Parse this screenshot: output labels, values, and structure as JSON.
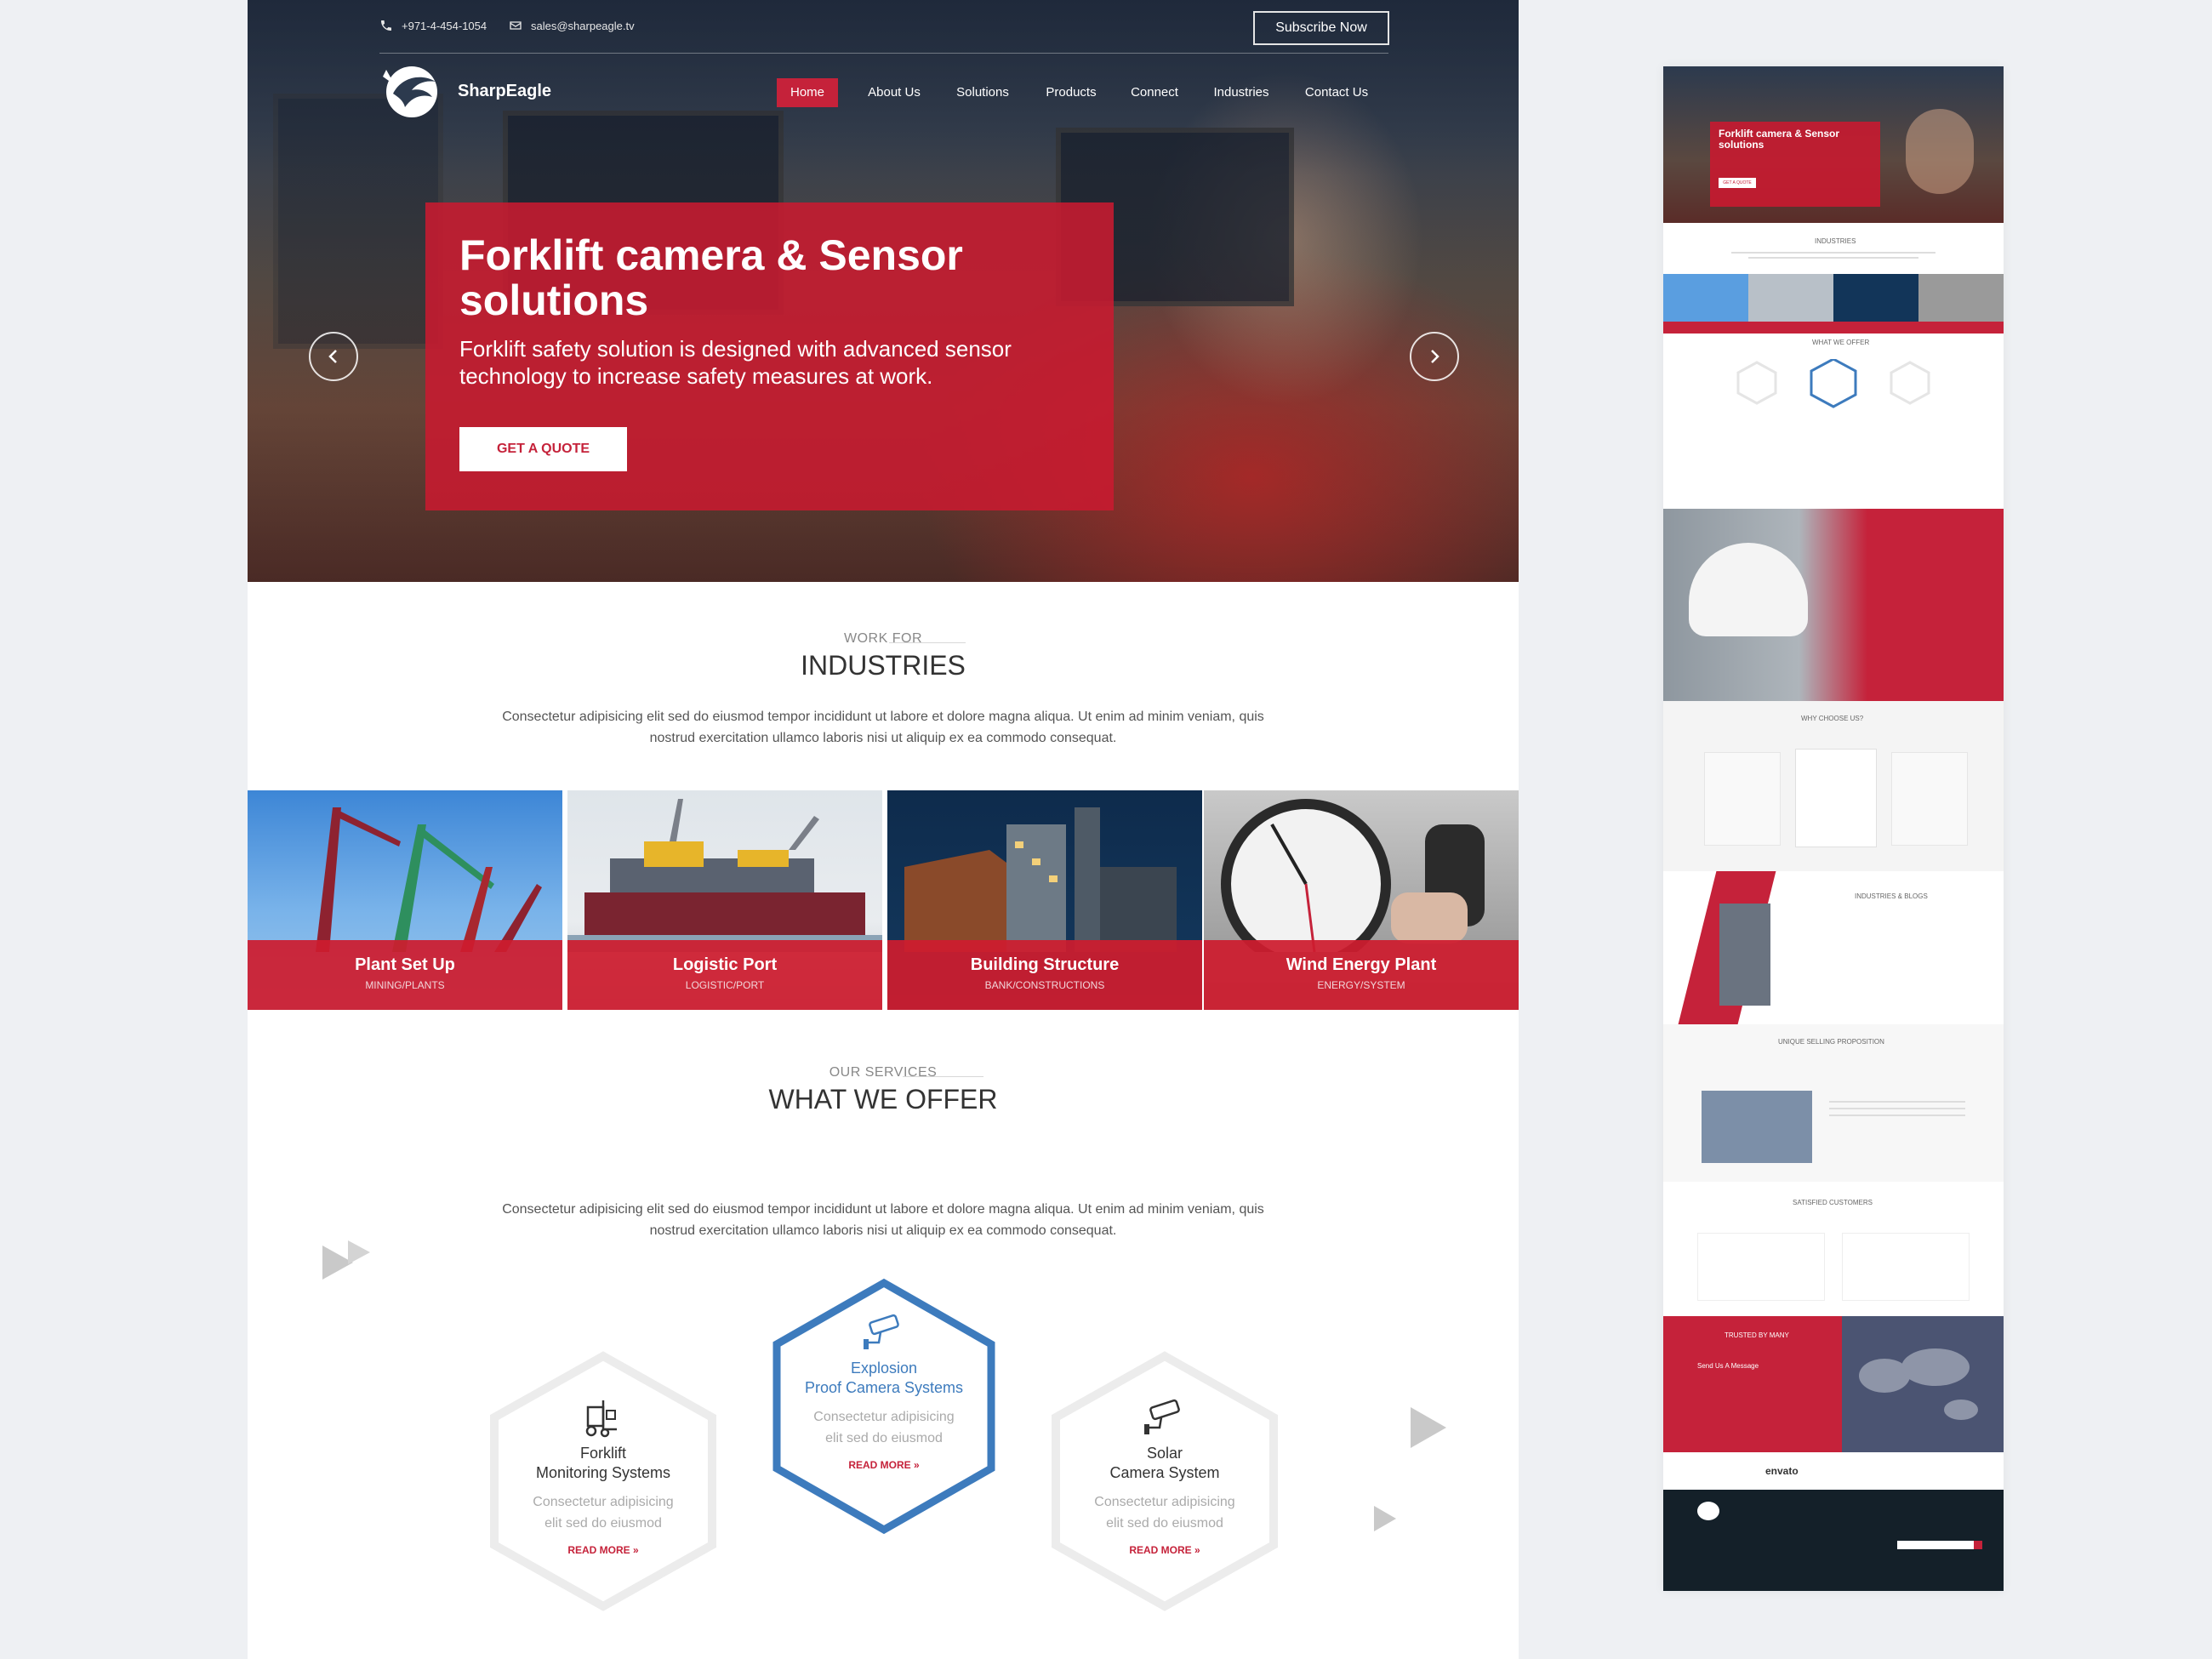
{
  "topbar": {
    "phone": "+971-4-454-1054",
    "email": "sales@sharpeagle.tv",
    "subscribe_label": "Subscribe Now"
  },
  "brand": {
    "name": "SharpEagle",
    "accent": "#c5223a",
    "blue": "#3d7bbd"
  },
  "nav": {
    "items": [
      {
        "label": "Home",
        "active": true
      },
      {
        "label": "About Us"
      },
      {
        "label": "Solutions"
      },
      {
        "label": "Products"
      },
      {
        "label": "Connect"
      },
      {
        "label": "Industries"
      },
      {
        "label": "Contact Us"
      }
    ]
  },
  "hero": {
    "title": "Forklift camera & Sensor solutions",
    "subtitle": "Forklift safety solution is designed with advanced sensor technology to increase safety measures at work.",
    "cta_label": "GET A QUOTE",
    "prev_icon": "chevron-left-icon",
    "next_icon": "chevron-right-icon"
  },
  "industries": {
    "kicker": "WORK FOR",
    "title": "INDUSTRIES",
    "text": "Consectetur adipisicing elit sed do eiusmod tempor incididunt ut labore et dolore magna aliqua. Ut enim ad minim veniam, quis nostrud exercitation ullamco laboris nisi ut aliquip ex ea commodo consequat.",
    "tiles": [
      {
        "name": "Plant Set Up",
        "sub": "MINING/PLANTS"
      },
      {
        "name": "Logistic Port",
        "sub": "LOGISTIC/PORT"
      },
      {
        "name": "Building Structure",
        "sub": "BANK/CONSTRUCTIONS"
      },
      {
        "name": "Wind Energy Plant",
        "sub": "ENERGY/SYSTEM"
      }
    ]
  },
  "services": {
    "kicker": "OUR SERVICES",
    "title": "WHAT WE OFFER",
    "text": "Consectetur adipisicing elit sed do eiusmod tempor incididunt ut labore et dolore magna aliqua. Ut enim ad minim veniam, quis nostrud exercitation ullamco laboris nisi ut aliquip ex ea commodo consequat.",
    "cards": [
      {
        "title_line1": "Forklift",
        "title_line2": "Monitoring Systems",
        "desc_line1": "Consectetur adipisicing",
        "desc_line2": "elit sed do eiusmod",
        "more": "READ MORE »",
        "icon": "forklift-icon"
      },
      {
        "title_line1": "Explosion",
        "title_line2": "Proof Camera Systems",
        "desc_line1": "Consectetur adipisicing",
        "desc_line2": "elit sed do eiusmod",
        "more": "READ MORE »",
        "icon": "security-camera-icon",
        "featured": true
      },
      {
        "title_line1": "Solar",
        "title_line2": "Camera System",
        "desc_line1": "Consectetur adipisicing",
        "desc_line2": "elit sed do eiusmod",
        "more": "READ MORE »",
        "icon": "security-camera-icon"
      }
    ]
  },
  "preview": {
    "hero_title": "Forklift camera & Sensor solutions",
    "hero_cta": "GET A QUOTE",
    "industries_title": "INDUSTRIES",
    "offer_title": "WHAT WE OFFER",
    "why_title": "WHY CHOOSE US?",
    "blogs_title": "INDUSTRIES & BLOGS",
    "usp_title": "UNIQUE SELLING PROPOSITION",
    "customers_title": "SATISFIED CUSTOMERS",
    "trusted_title": "TRUSTED BY MANY",
    "message_label": "Send Us A Message",
    "envato": "envato"
  }
}
